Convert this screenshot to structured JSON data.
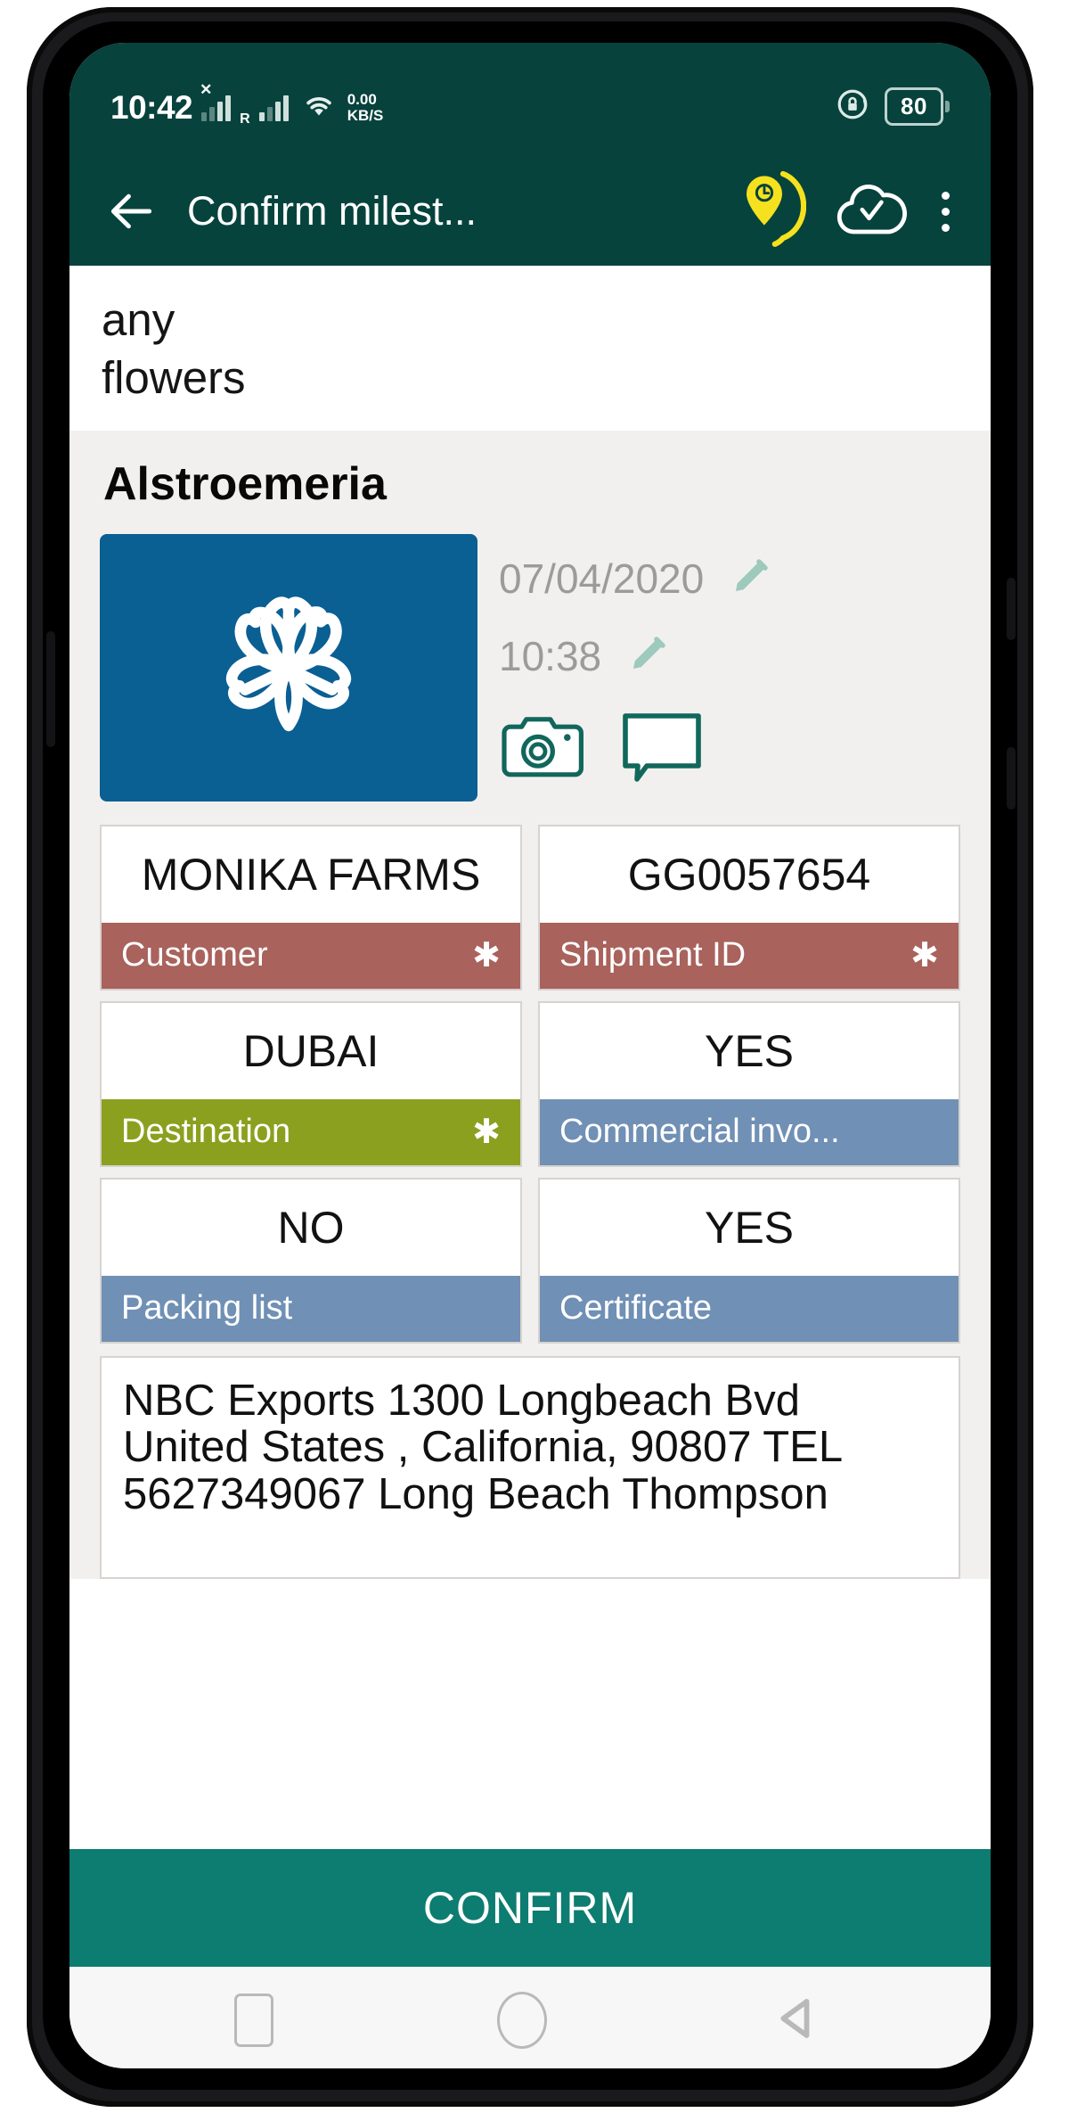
{
  "status_bar": {
    "time": "10:42",
    "net_speed_value": "0.00",
    "net_speed_unit": "KB/S",
    "roaming_letter": "R",
    "battery_level": "80",
    "icons": [
      "signal-bars-icon",
      "roaming-icon",
      "wifi-icon",
      "rotation-lock-icon",
      "battery-icon"
    ]
  },
  "app_bar": {
    "title": "Confirm milest...",
    "back_icon": "back-arrow-icon",
    "location_icon": "location-pin-clock-icon",
    "cloud_icon": "cloud-check-icon",
    "overflow_icon": "more-vertical-icon"
  },
  "notes": {
    "lines": [
      "any",
      "flowers"
    ]
  },
  "product": {
    "title": "Alstroemeria",
    "thumb_icon": "flower-logo-icon",
    "date": "07/04/2020",
    "time": "10:38",
    "date_edit_icon": "pencil-icon",
    "time_edit_icon": "pencil-icon",
    "camera_icon": "camera-icon",
    "comment_icon": "comment-bubble-icon"
  },
  "fields": [
    {
      "value": "MONIKA FARMS",
      "label": "Customer",
      "required": true,
      "marker": "✱",
      "color": "#a9625c"
    },
    {
      "value": "GG0057654",
      "label": "Shipment ID",
      "required": true,
      "marker": "✱",
      "color": "#a9625c"
    },
    {
      "value": "DUBAI",
      "label": "Destination",
      "required": true,
      "marker": "✱",
      "color": "#8ba01e"
    },
    {
      "value": "YES",
      "label": "Commercial invo...",
      "required": false,
      "marker": "",
      "color": "#7090b5"
    },
    {
      "value": "NO",
      "label": "Packing list",
      "required": false,
      "marker": "",
      "color": "#7090b5"
    },
    {
      "value": "YES",
      "label": "Certificate",
      "required": false,
      "marker": "",
      "color": "#7090b5"
    }
  ],
  "address": {
    "text": "NBC Exports 1300 Longbeach Bvd United States , California, 90807 TEL 5627349067 Long Beach Thompson"
  },
  "confirm": {
    "label": "CONFIRM"
  },
  "nav_bar": {
    "recents_icon": "square-recents-icon",
    "home_icon": "circle-home-icon",
    "back_icon": "triangle-back-icon"
  },
  "colors": {
    "status_bar": "#07423c",
    "app_bar": "#07433d",
    "confirm": "#0d7c71",
    "thumb": "#0a5f93",
    "accent_yellow": "#f5e11e",
    "label_red": "#a9625c",
    "label_olive": "#8ba01e",
    "label_blue": "#7090b5"
  }
}
